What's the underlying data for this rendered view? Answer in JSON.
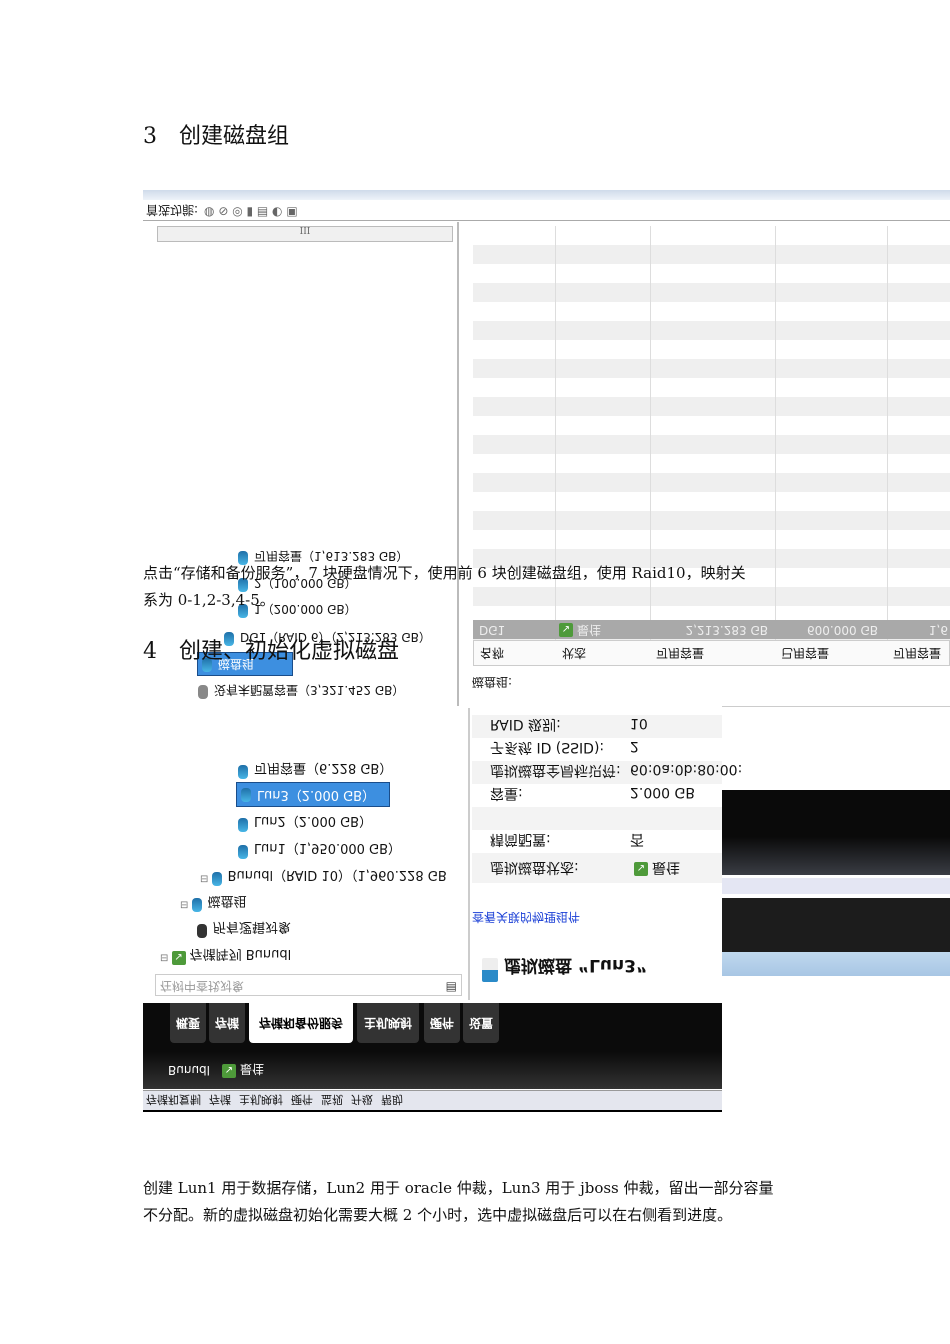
{
  "section3": {
    "number": "3",
    "title": "创建磁盘组"
  },
  "para1": {
    "line1": "点击“存储和备份服务”，7 块硬盘情况下，使用前 6 块创建磁盘组，使用 Raid10，映射关",
    "line2": "系为 0-1,2-3,4-5。"
  },
  "section4": {
    "number": "4",
    "title": "创建、初始化虚拟磁盘"
  },
  "para2": {
    "line1": "创建 Lun1 用于数据存储，Lun2 用于 oracle 仲裁，Lun3 用于 jboss 仲裁，留出一部分容量",
    "line2": "不分配。新的虚拟磁盘初始化需要大概 2 个小时，选中虚拟磁盘后可以在右侧看到进度。"
  },
  "shot1": {
    "toolbar_label": "首选功能:",
    "scroll_grip": "III",
    "tree": [
      {
        "label": "可用容量（1,613.283 GB）"
      },
      {
        "label": "2（100.000 GB）"
      },
      {
        "label": "1（200.000 GB）"
      },
      {
        "label": "DG1（RAID 6）（2,213.283 GB）"
      },
      {
        "label": "磁盘组"
      },
      {
        "label": "没有未配置容量（3,321.452 GB）"
      }
    ],
    "table": {
      "headers": [
        "名称",
        "状态",
        "可用容量",
        "已用容量",
        "可用容量"
      ],
      "row": [
        "DG1",
        "最佳",
        "2,213.283 GB",
        "600.000 GB",
        "1,6"
      ]
    },
    "caption": "磁盘组:"
  },
  "shot2": {
    "tree": [
      {
        "label": "可用容量（6.228 GB）"
      },
      {
        "label": "Lun3（2.000 GB）"
      },
      {
        "label": "Lun2（2.000 GB）"
      },
      {
        "label": "Lun1（1,950.000 GB）"
      },
      {
        "label": "Bunudl（RAID 10）（1,960.228 GB"
      },
      {
        "label": "磁盘组"
      },
      {
        "label": "所有逻辑对象"
      },
      {
        "label": "存储阵列 Bunudl"
      }
    ],
    "search_placeholder": "在树中查找对象",
    "props": [
      {
        "k": "RAID 级别:",
        "v": "10"
      },
      {
        "k": "子系统 ID (SSID):",
        "v": "2"
      },
      {
        "k": "虚拟磁盘全局标识符:",
        "v": "60:0a:0b:80:00:"
      },
      {
        "k": "容量:",
        "v": "2.000 GB"
      },
      {
        "k": "精简配置:",
        "v": "否"
      },
      {
        "k": "虚拟磁盘状态:",
        "v": "最佳"
      }
    ],
    "link": "查看关联的物理组件",
    "detail_title": "虚拟磁盘 “Lun3”",
    "tabs": [
      "概要",
      "存储",
      "存储和备份服务",
      "主机映射",
      "硬件",
      "设置"
    ],
    "status_name": "Bunudl",
    "status_value": "最佳",
    "menu": [
      "存储和复制",
      "存储",
      "主机映射",
      "硬件",
      "监视",
      "升级",
      "帮助"
    ]
  }
}
